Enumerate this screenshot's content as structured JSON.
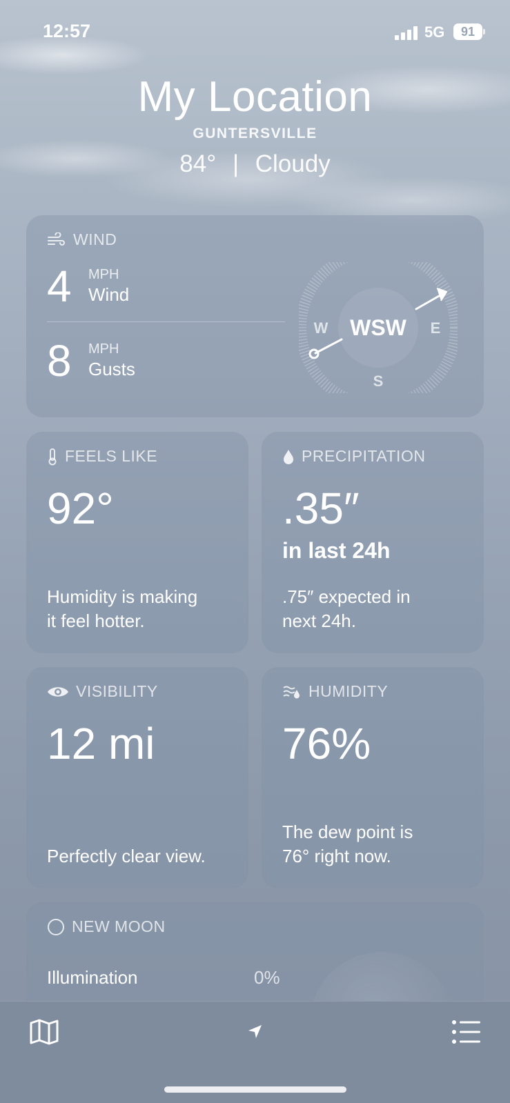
{
  "status": {
    "time": "12:57",
    "network": "5G",
    "battery": "91"
  },
  "header": {
    "title": "My Location",
    "city": "GUNTERSVILLE",
    "temp": "84°",
    "separator": "|",
    "condition": "Cloudy"
  },
  "wind": {
    "title": "WIND",
    "wind_value": "4",
    "wind_unit": "MPH",
    "wind_label": "Wind",
    "gust_value": "8",
    "gust_unit": "MPH",
    "gust_label": "Gusts",
    "direction": "WSW",
    "compass_w": "W",
    "compass_e": "E",
    "compass_s": "S"
  },
  "feels_like": {
    "title": "FEELS LIKE",
    "value": "92°",
    "desc_line1": "Humidity is making",
    "desc_line2": "it feel hotter."
  },
  "precipitation": {
    "title": "PRECIPITATION",
    "value": ".35″",
    "sub": "in last 24h",
    "desc_line1": ".75″ expected in",
    "desc_line2": "next 24h."
  },
  "visibility": {
    "title": "VISIBILITY",
    "value": "12 mi",
    "desc": "Perfectly clear view."
  },
  "humidity": {
    "title": "HUMIDITY",
    "value": "76%",
    "desc_line1": "The dew point is",
    "desc_line2": "76° right now."
  },
  "moon": {
    "title": "NEW MOON",
    "illumination_label": "Illumination",
    "illumination_value": "0%"
  },
  "icons": [
    "map-icon",
    "location-arrow-icon",
    "list-icon",
    "wind-icon",
    "thermometer-icon",
    "droplet-icon",
    "eye-icon",
    "humidity-icon",
    "moon-icon"
  ]
}
